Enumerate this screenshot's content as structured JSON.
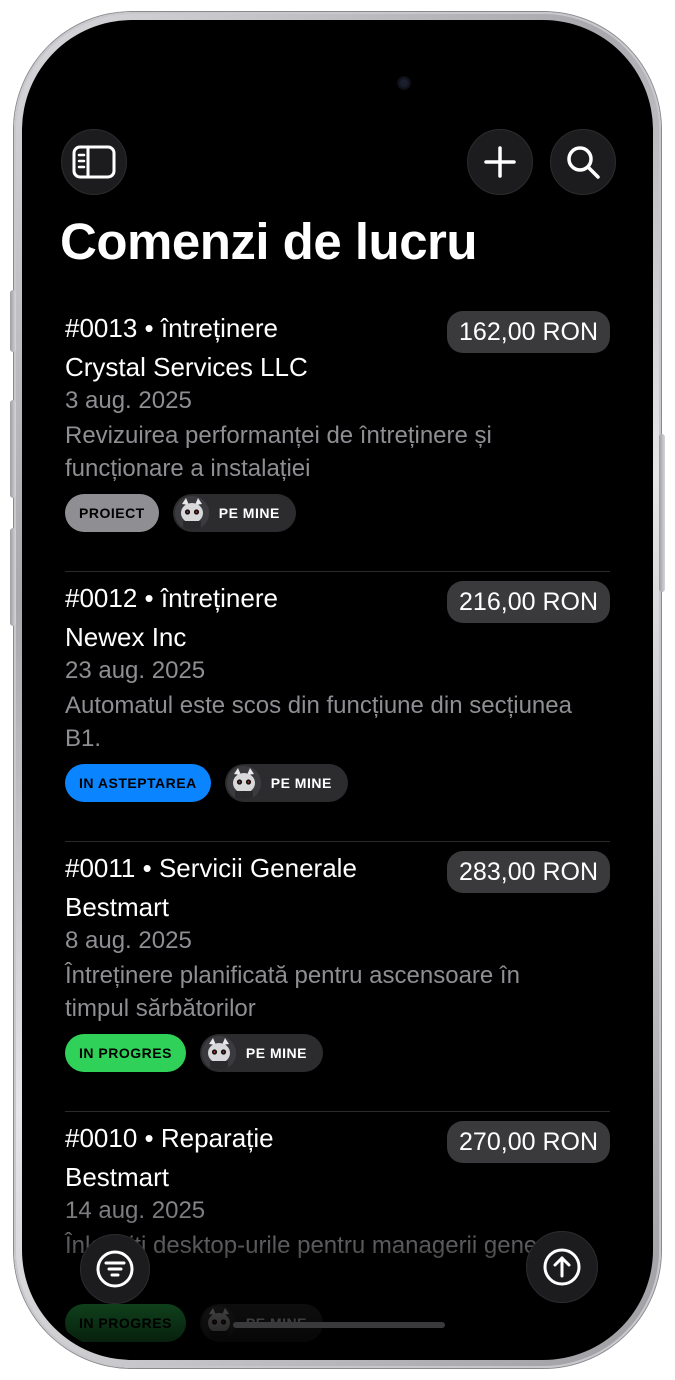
{
  "header": {
    "title": "Comenzi de lucru"
  },
  "work_orders": [
    {
      "number": "#0013",
      "category": "întreținere",
      "price": "162,00 RON",
      "client": "Crystal Services LLC",
      "date": "3 aug. 2025",
      "description": "Revizuirea performanței de întreținere și funcționare a instalației",
      "status": "PROIECT",
      "status_color": "#8e8e93",
      "status_text_color": "#000000",
      "assignee": "PE MINE"
    },
    {
      "number": "#0012",
      "category": "întreținere",
      "price": "216,00 RON",
      "client": "Newex Inc",
      "date": "23 aug. 2025",
      "description": "Automatul este scos din funcțiune din secțiunea B1.",
      "status": "IN ASTEPTAREA",
      "status_color": "#0a84ff",
      "status_text_color": "#000000",
      "assignee": "PE MINE"
    },
    {
      "number": "#0011",
      "category": "Servicii Generale",
      "price": "283,00 RON",
      "client": "Bestmart",
      "date": "8 aug. 2025",
      "description": "Întreținere planificată pentru ascensoare în timpul sărbătorilor",
      "status": "IN PROGRES",
      "status_color": "#30d158",
      "status_text_color": "#000000",
      "assignee": "PE MINE"
    },
    {
      "number": "#0010",
      "category": "Reparație",
      "price": "270,00 RON",
      "client": "Bestmart",
      "date": "14 aug. 2025",
      "description": "Înlocuiți desktop-urile pentru managerii generali",
      "status": "IN PROGRES",
      "status_color": "#30d158",
      "status_text_color": "#000000",
      "assignee": "PE MINE"
    }
  ],
  "icons": {
    "sidebar": "sidebar-icon",
    "add": "plus-icon",
    "search": "search-icon",
    "filter": "filter-icon",
    "scroll_top": "arrow-up-circle-icon"
  }
}
